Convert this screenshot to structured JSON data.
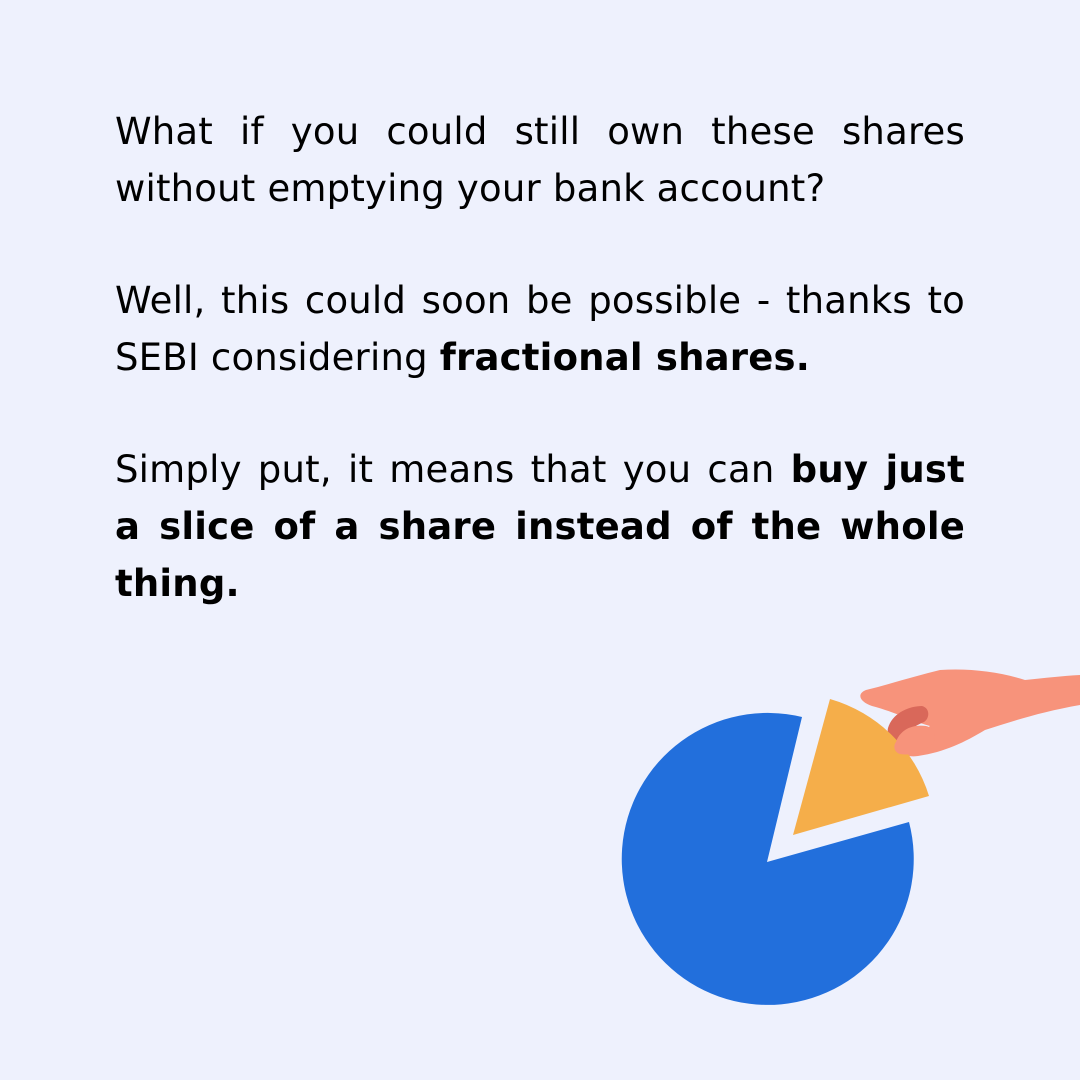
{
  "paragraphs": [
    {
      "text": "What if you could still own these shares without emptying your bank account?"
    },
    {
      "text": "Well, this could soon be possible - thanks to SEBI considering ",
      "bold": "fractional shares."
    },
    {
      "text": "Simply put, it means that you can ",
      "bold": "buy just a slice of a share instead of the whole thing."
    }
  ],
  "colors": {
    "background": "#eef1fd",
    "pie": "#226fdc",
    "slice": "#f5ae4a",
    "hand": "#f7937b",
    "hand_shadow": "#d9685a"
  },
  "illustration": {
    "icon": "hand-taking-pie-slice-icon"
  }
}
